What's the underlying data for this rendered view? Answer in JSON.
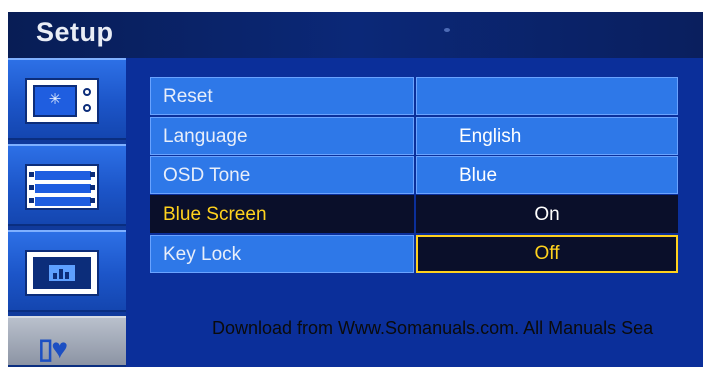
{
  "header": {
    "title": "Setup"
  },
  "sidebar": {
    "tabs": [
      {
        "icon": "picture-settings-icon"
      },
      {
        "icon": "film-strip-icon"
      },
      {
        "icon": "picture-frame-icon"
      },
      {
        "icon": "tools-icon"
      }
    ]
  },
  "menu": {
    "rows": [
      {
        "label": "Reset",
        "value": ""
      },
      {
        "label": "Language",
        "value": "English"
      },
      {
        "label": "OSD Tone",
        "value": "Blue"
      },
      {
        "label": "Blue Screen",
        "value": "On"
      },
      {
        "label": "Key Lock",
        "value": "Off"
      }
    ],
    "selected_row": "Blue Screen",
    "active_value_row": "Key Lock"
  },
  "watermark": {
    "text": "Download from Www.Somanuals.com. All Manuals Sea"
  },
  "colors": {
    "background": "#0a2a8c",
    "row": "#2e78e8",
    "selected": "#0a0f2a",
    "highlight_text": "#ffd21e"
  }
}
